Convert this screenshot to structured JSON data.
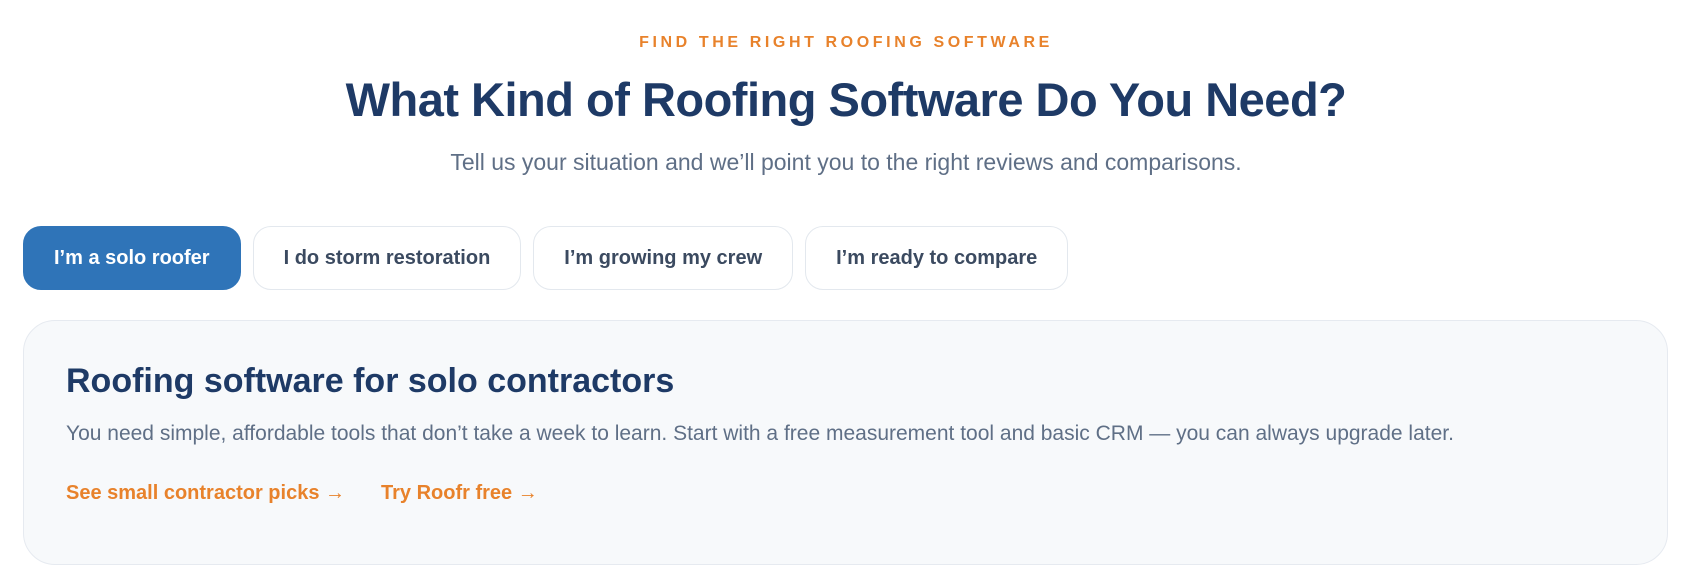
{
  "header": {
    "eyebrow": "FIND THE RIGHT ROOFING SOFTWARE",
    "title": "What Kind of Roofing Software Do You Need?",
    "subtitle": "Tell us your situation and we’ll point you to the right reviews and comparisons."
  },
  "tabs": [
    {
      "label": "I’m a solo roofer",
      "active": true
    },
    {
      "label": "I do storm restoration",
      "active": false
    },
    {
      "label": "I’m growing my crew",
      "active": false
    },
    {
      "label": "I’m ready to compare",
      "active": false
    }
  ],
  "panel": {
    "title": "Roofing software for solo contractors",
    "description": "You need simple, affordable tools that don’t take a week to learn. Start with a free measurement tool and basic CRM — you can always upgrade later.",
    "links": [
      {
        "label": "See small contractor picks →"
      },
      {
        "label": "Try Roofr free →"
      }
    ]
  },
  "colors": {
    "accent": "#e8822b",
    "heading": "#1e3a66",
    "active_tab": "#2f74b8",
    "body_text": "#5f6f86"
  }
}
